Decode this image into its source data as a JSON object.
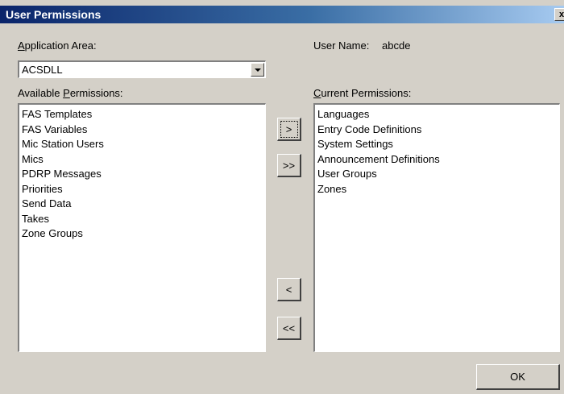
{
  "window": {
    "title": "User Permissions",
    "close_glyph": "x"
  },
  "application_area": {
    "label_accel": "A",
    "label_rest": "pplication Area:",
    "value": "ACSDLL"
  },
  "user_name": {
    "label": "User Name:",
    "value": "abcde"
  },
  "available": {
    "label_pre": "Available ",
    "label_accel": "P",
    "label_rest": "ermissions:",
    "items": [
      "FAS Templates",
      "FAS Variables",
      "Mic Station Users",
      "Mics",
      "PDRP Messages",
      "Priorities",
      "Send Data",
      "Takes",
      "Zone Groups"
    ]
  },
  "current": {
    "label_accel": "C",
    "label_rest": "urrent Permissions:",
    "items": [
      "Languages",
      "Entry Code Definitions",
      "System Settings",
      "Announcement Definitions",
      "User Groups",
      "Zones"
    ]
  },
  "buttons": {
    "add_one": ">",
    "add_all": ">>",
    "remove_one": "<",
    "remove_all": "<<",
    "ok": "OK"
  }
}
